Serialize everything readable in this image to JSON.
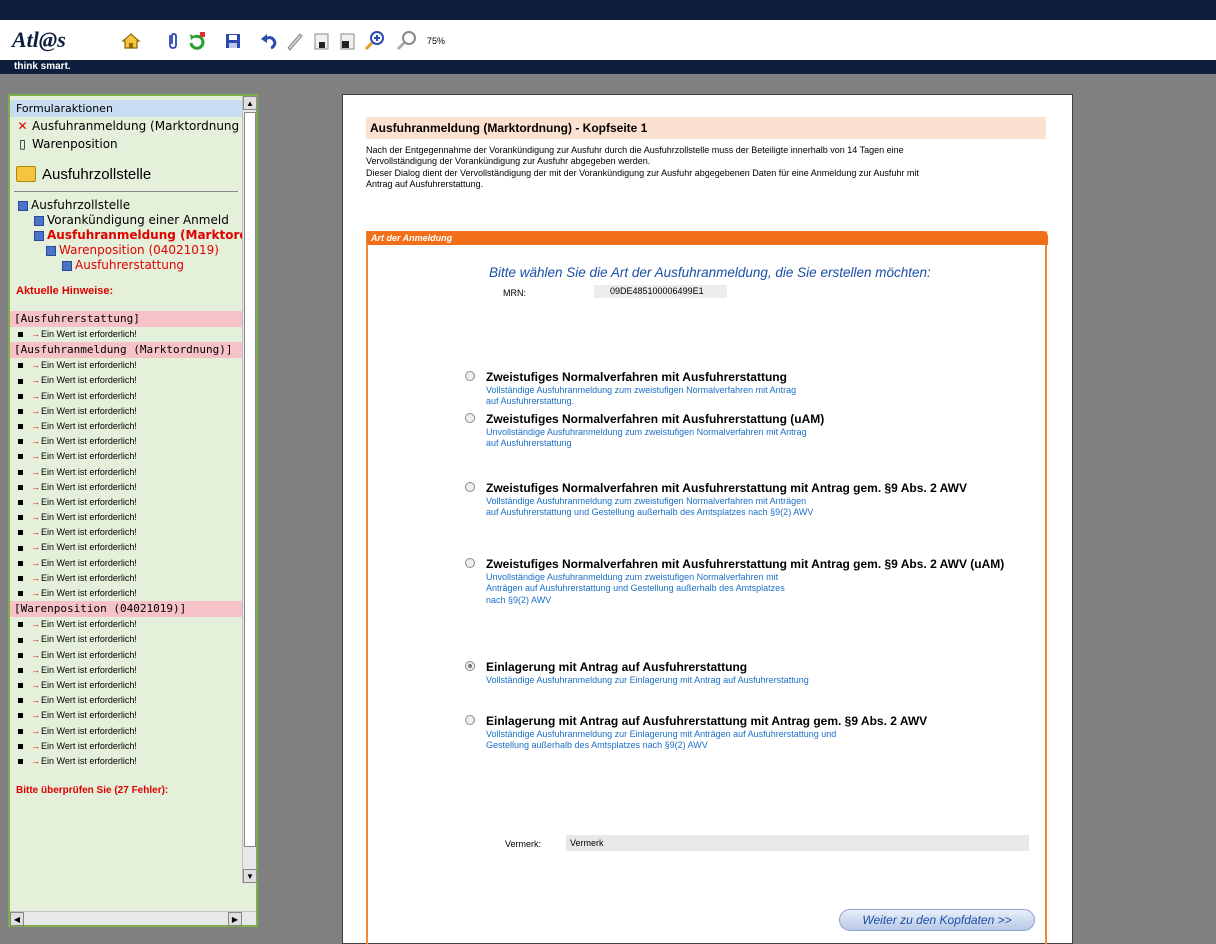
{
  "app": {
    "logo_text": "Atl@s",
    "tagline": "think smart.",
    "zoom": "75%"
  },
  "toolbar": {
    "icons": [
      "home-icon",
      "attachment-icon",
      "refresh-icon",
      "save-icon",
      "undo-icon",
      "edit-icon",
      "page-first-icon",
      "page-second-icon",
      "zoom-in-icon",
      "zoom-out-icon"
    ]
  },
  "sidebar": {
    "formularaktionen": "Formularaktionen",
    "items": [
      {
        "label": "Ausfuhranmeldung (Marktordnung",
        "icon": "close-icon"
      },
      {
        "label": "Warenposition",
        "icon": "document-icon"
      }
    ],
    "section_title": "Ausfuhrzollstelle",
    "tree": [
      {
        "label": "Ausfuhrzollstelle"
      },
      {
        "label": "Vorankündigung einer Anmeld"
      },
      {
        "label": "Ausfuhranmeldung (Marktordr"
      },
      {
        "label": "Warenposition (04021019)"
      },
      {
        "label": "Ausfuhrerstattung"
      }
    ],
    "hints_title": "Aktuelle Hinweise:",
    "group1": "[Ausfuhrerstattung]",
    "group2": "[Ausfuhranmeldung (Marktordnung)]",
    "group3": "[Warenposition (04021019)]",
    "hint_text": "Ein Wert ist erforderlich!",
    "errors_title": "Bitte überprüfen Sie (27 Fehler):"
  },
  "page": {
    "heading": "Ausfuhranmeldung (Marktordnung) - Kopfseite 1",
    "intro_line1": "Nach der Entgegennahme der Vorankündigung zur Ausfuhr durch die Ausfuhrzollstelle muss der Beteiligte innerhalb von 14 Tagen eine",
    "intro_line2": "Vervollständigung der Vorankündigung zur Ausfuhr abgegeben werden.",
    "intro_line3": "Dieser Dialog dient der Vervollständigung der mit der Vorankündigung zur Ausfuhr abgegebenen Daten für eine Anmeldung zur Ausfuhr mit",
    "intro_line4": "Antrag auf Ausfuhrerstattung.",
    "section_label": "Art der Anmeldung",
    "choose_title": "Bitte wählen Sie die Art der Ausfuhranmeldung, die Sie erstellen möchten:",
    "mrn_label": "MRN:",
    "mrn_value": "09DE485100006499E1",
    "options": [
      {
        "title": "Zweistufiges Normalverfahren mit Ausfuhrerstattung",
        "desc1": "Vollständige Ausfuhranmeldung zum zweistufigen Normalverfahren mit Antrag",
        "desc2": "auf Ausfuhrerstattung.",
        "desc3": "",
        "checked": false
      },
      {
        "title": "Zweistufiges Normalverfahren mit Ausfuhrerstattung (uAM)",
        "desc1": "Unvollständige Ausfuhranmeldung zum zweistufigen Normalverfahren mit Antrag",
        "desc2": "auf Ausfuhrerstattung",
        "desc3": "",
        "checked": false
      },
      {
        "title": "Zweistufiges Normalverfahren mit Ausfuhrerstattung mit Antrag gem. §9 Abs. 2 AWV",
        "desc1": "Vollständige Ausfuhranmeldung zum zweistufigen Normalverfahren mit Anträgen",
        "desc2": "auf Ausfuhrerstattung und Gestellung außerhalb des Amtsplatzes nach §9(2) AWV",
        "desc3": "",
        "checked": false
      },
      {
        "title": "Zweistufiges Normalverfahren mit Ausfuhrerstattung mit Antrag gem. §9 Abs. 2 AWV (uAM)",
        "desc1": "Unvollständige Ausfuhranmeldung zum zweistufigen Normalverfahren mit",
        "desc2": "Anträgen auf Ausfuhrerstattung und Gestellung außerhalb des Amtsplatzes",
        "desc3": "nach §9(2) AWV",
        "checked": false
      },
      {
        "title": "Einlagerung mit Antrag auf Ausfuhrerstattung",
        "desc1": "Vollständige Ausfuhranmeldung zur Einlagerung mit Antrag auf Ausfuhrerstattung",
        "desc2": "",
        "desc3": "",
        "checked": true
      },
      {
        "title": "Einlagerung mit Antrag auf Ausfuhrerstattung mit Antrag gem. §9 Abs. 2 AWV",
        "desc1": "Vollständige Ausfuhranmeldung zur Einlagerung mit Anträgen auf Ausfuhrerstattung und",
        "desc2": "Gestellung außerhalb des Amtsplatzes nach §9(2) AWV",
        "desc3": "",
        "checked": false
      }
    ],
    "vermerk_label": "Vermerk:",
    "vermerk_value": "Vermerk",
    "next_button": "Weiter zu den Kopfdaten  >>"
  }
}
